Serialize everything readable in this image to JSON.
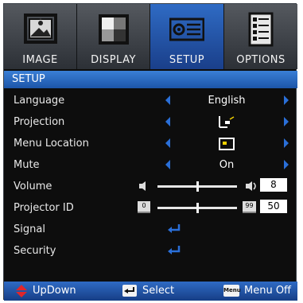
{
  "tabs": [
    {
      "label": "IMAGE",
      "icon": "image-icon"
    },
    {
      "label": "DISPLAY",
      "icon": "display-icon"
    },
    {
      "label": "SETUP",
      "icon": "projector-icon",
      "active": true
    },
    {
      "label": "OPTIONS",
      "icon": "options-icon"
    }
  ],
  "section_title": "SETUP",
  "rows": {
    "language": {
      "label": "Language",
      "value": "English"
    },
    "projection": {
      "label": "Projection",
      "icon": "projection-mode-icon"
    },
    "menu_location": {
      "label": "Menu Location",
      "icon": "menu-location-icon"
    },
    "mute": {
      "label": "Mute",
      "value": "On"
    },
    "volume": {
      "label": "Volume",
      "value": "8",
      "level": 0.5
    },
    "projector_id": {
      "label": "Projector ID",
      "value": "50",
      "min_label": "0",
      "max_label": "99",
      "level": 0.5
    },
    "signal": {
      "label": "Signal",
      "icon": "enter-icon"
    },
    "security": {
      "label": "Security",
      "icon": "enter-icon"
    }
  },
  "footer": {
    "updown": "UpDown",
    "select": "Select",
    "menu_off": "Menu Off",
    "menu_key": "Menu"
  },
  "colors": {
    "accent": "#2a6fd8",
    "background": "#0d0d0d",
    "footer_arrow": "#e0262b"
  }
}
